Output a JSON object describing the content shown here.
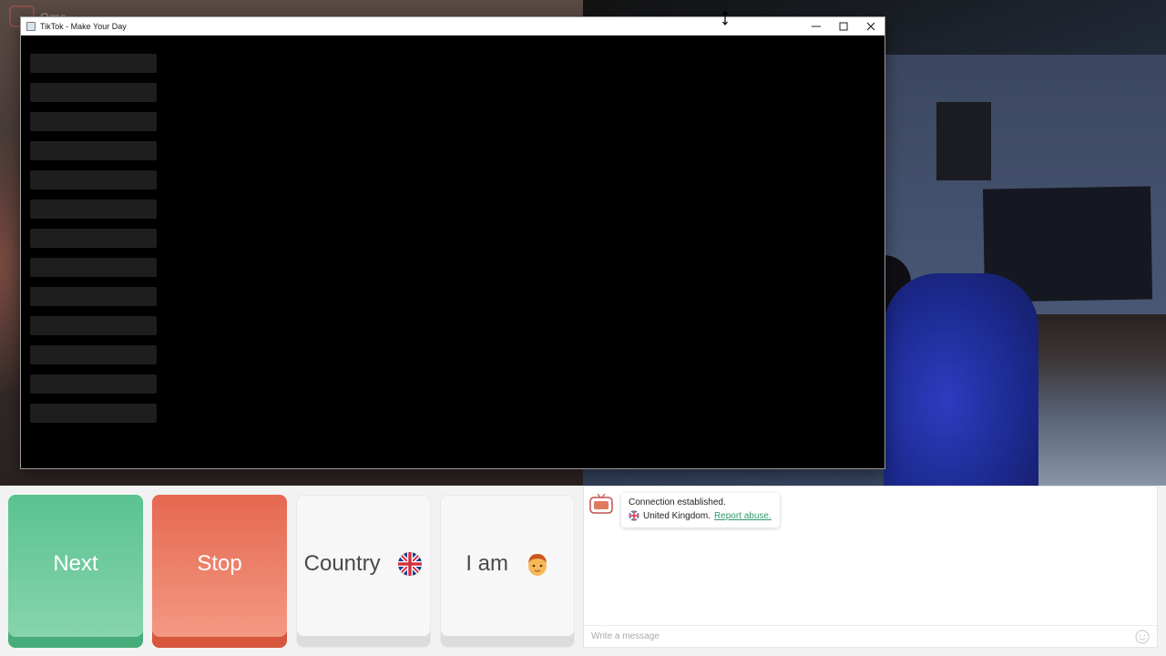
{
  "background_logo_text": "Ome",
  "window": {
    "title": "TikTok - Make Your Day",
    "skeleton_rows": 13
  },
  "buttons": {
    "next": "Next",
    "stop": "Stop",
    "country": "Country",
    "country_flag": "united-kingdom-flag-icon",
    "i_am": "I am",
    "i_am_icon": "boy-emoji-icon"
  },
  "chat": {
    "status": "Connection established.",
    "country": "United Kingdom.",
    "report_link": "Report abuse.",
    "input_placeholder": "Write a message"
  },
  "colors": {
    "next": "#5ac290",
    "stop": "#e66850",
    "link": "#2f9a6e"
  }
}
